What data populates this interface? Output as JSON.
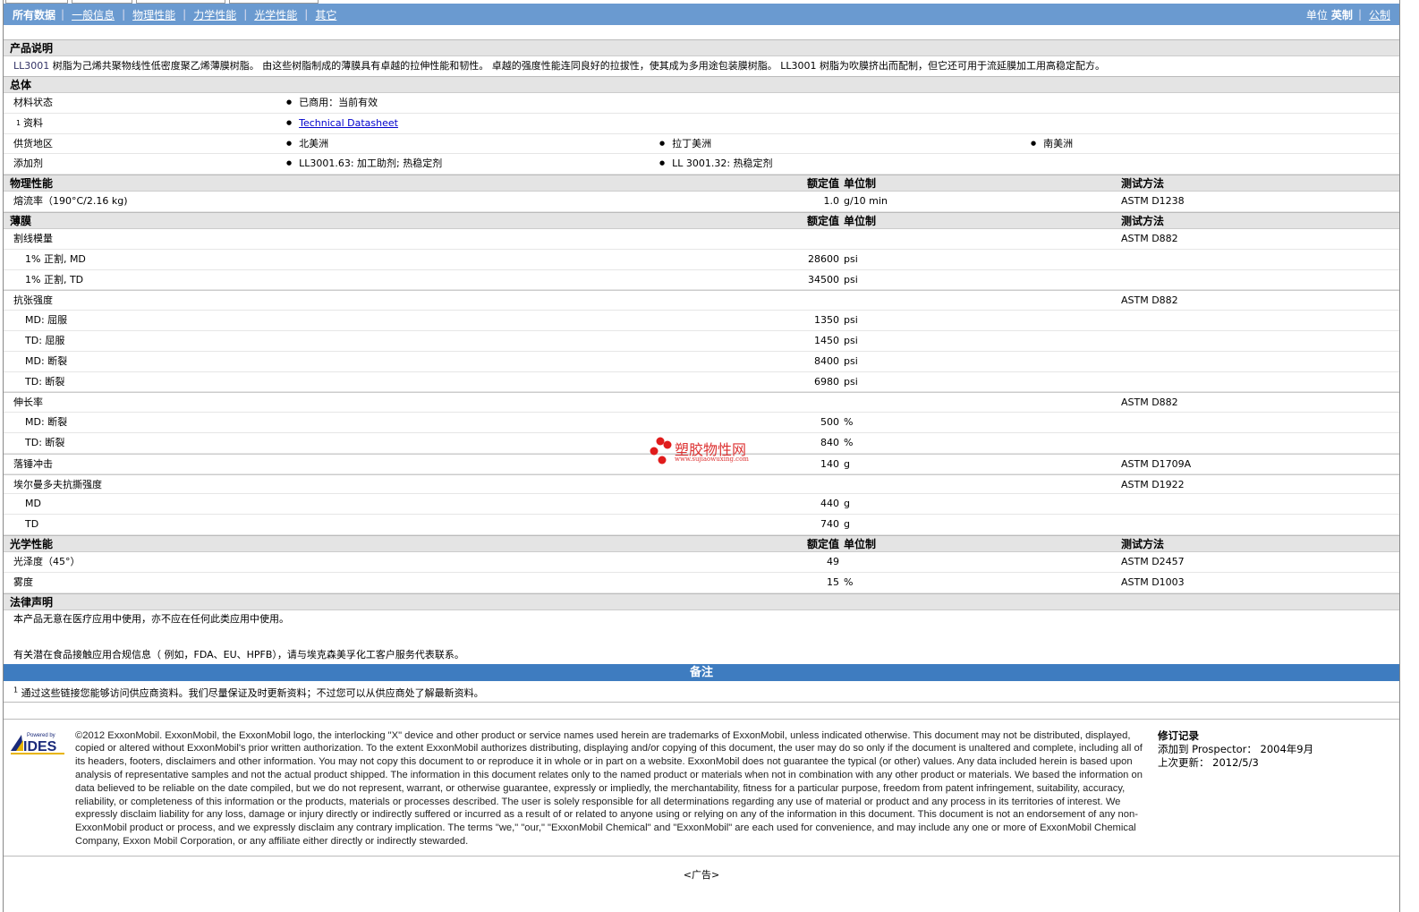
{
  "nav": {
    "items": [
      "所有数据",
      "一般信息",
      "物理性能",
      "力学性能",
      "光学性能",
      "其它"
    ],
    "unit_label": "单位",
    "unit_english": "英制",
    "unit_metric": "公制"
  },
  "product": {
    "header": "产品说明",
    "name": "LL3001",
    "desc": " 树脂为己烯共聚物线性低密度聚乙烯薄膜树脂。 由这些树脂制成的薄膜具有卓越的拉伸性能和韧性。 卓越的强度性能连同良好的拉拔性，使其成为多用途包装膜树脂。 LL3001 树脂为吹膜挤出而配制，但它还可用于流延膜加工用高稳定配方。"
  },
  "general": {
    "header": "总体",
    "rows": [
      {
        "label": "材料状态",
        "values": [
          "已商用：当前有效"
        ]
      },
      {
        "label": "资料",
        "sup": "1",
        "link": "Technical Datasheet"
      },
      {
        "label": "供货地区",
        "values": [
          "北美洲",
          "拉丁美洲",
          "南美洲"
        ]
      },
      {
        "label": "添加剂",
        "values": [
          "LL3001.63: 加工助剂; 热稳定剂",
          "LL 3001.32: 热稳定剂"
        ]
      }
    ]
  },
  "cols": {
    "value": "额定值",
    "unit": "单位制",
    "method": "测试方法"
  },
  "sections": [
    {
      "header": "物理性能",
      "rows": [
        {
          "label": "熔流率（190°C/2.16 kg)",
          "value": "1.0",
          "unit": "g/10 min",
          "method": "ASTM D1238"
        }
      ]
    },
    {
      "header": "薄膜",
      "rows": [
        {
          "label": "割线模量",
          "method": "ASTM D882",
          "group": true
        },
        {
          "label": "1% 正割, MD",
          "value": "28600",
          "unit": "psi",
          "sub": true
        },
        {
          "label": "1% 正割, TD",
          "value": "34500",
          "unit": "psi",
          "sub": true
        },
        {
          "label": "抗张强度",
          "method": "ASTM D882",
          "group": true
        },
        {
          "label": "MD: 屈服",
          "value": "1350",
          "unit": "psi",
          "sub": true
        },
        {
          "label": "TD: 屈服",
          "value": "1450",
          "unit": "psi",
          "sub": true
        },
        {
          "label": "MD: 断裂",
          "value": "8400",
          "unit": "psi",
          "sub": true
        },
        {
          "label": "TD: 断裂",
          "value": "6980",
          "unit": "psi",
          "sub": true
        },
        {
          "label": "伸长率",
          "method": "ASTM D882",
          "group": true
        },
        {
          "label": "MD: 断裂",
          "value": "500",
          "unit": "%",
          "sub": true
        },
        {
          "label": "TD: 断裂",
          "value": "840",
          "unit": "%",
          "sub": true
        },
        {
          "label": "落锤冲击",
          "value": "140",
          "unit": "g",
          "method": "ASTM D1709A",
          "group": true
        },
        {
          "label": "埃尔曼多夫抗撕强度",
          "method": "ASTM D1922",
          "group": true
        },
        {
          "label": "MD",
          "value": "440",
          "unit": "g",
          "sub": true
        },
        {
          "label": "TD",
          "value": "740",
          "unit": "g",
          "sub": true
        }
      ]
    },
    {
      "header": "光学性能",
      "rows": [
        {
          "label": "光泽度（45°）",
          "value": "49",
          "method": "ASTM D2457"
        },
        {
          "label": "雾度",
          "value": "15",
          "unit": "%",
          "method": "ASTM D1003"
        }
      ]
    }
  ],
  "legal": {
    "header": "法律声明",
    "line1": "本产品无意在医疗应用中使用，亦不应在任何此类应用中使用。",
    "line2": "有关潜在食品接触应用合规信息（ 例如，FDA、EU、HPFB），请与埃克森美孚化工客户服务代表联系。"
  },
  "notes": {
    "header": "备注",
    "sup": "1",
    "text": " 通过这些链接您能够访问供应商资料。我们尽量保证及时更新资料；不过您可以从供应商处了解最新资料。"
  },
  "logo": {
    "powered": "Powered by",
    "name": "IDES"
  },
  "copyright": "©2012 ExxonMobil. ExxonMobil, the ExxonMobil logo, the interlocking \"X\" device and other product or service names used herein are trademarks of ExxonMobil, unless indicated otherwise. This document may not be distributed, displayed, copied or altered without ExxonMobil's prior written authorization. To the extent ExxonMobil authorizes distributing, displaying and/or copying of this document, the user may do so only if the document is unaltered and complete, including all of its headers, footers, disclaimers and other information. You may not copy this document to or reproduce it in whole or in part on a website. ExxonMobil does not guarantee the typical (or other) values. Any data included herein is based upon analysis of representative samples and not the actual product shipped. The information in this document relates only to the named product or materials when not in combination with any other product or materials. We based the information on data believed to be reliable on the date compiled, but we do not represent, warrant, or otherwise guarantee, expressly or impliedly, the merchantability, fitness for a particular purpose, freedom from patent infringement, suitability, accuracy, reliability, or completeness of this information or the products, materials or processes described. The user is solely responsible for all determinations regarding any use of material or product and any process in its territories of interest. We expressly disclaim liability for any loss, damage or injury directly or indirectly suffered or incurred as a result of or related to anyone using or relying on any of the information in this document. This document is not an endorsement of any non-ExxonMobil product or process, and we expressly disclaim any contrary implication. The terms \"we,\" \"our,\" \"ExxonMobil Chemical\" and \"ExxonMobil\" are each used for convenience, and may include any one or more of ExxonMobil Chemical Company, Exxon Mobil Corporation, or any affiliate either directly or indirectly stewarded.",
  "revision": {
    "header": "修订记录",
    "added_label": "添加到 Prospector：",
    "added": "2004年9月",
    "updated_label": "上次更新：",
    "updated": "2012/5/3"
  },
  "ad": "<广告>",
  "watermark": {
    "name": "塑胶物性网",
    "url": "www.sujiaowuxing.com"
  }
}
